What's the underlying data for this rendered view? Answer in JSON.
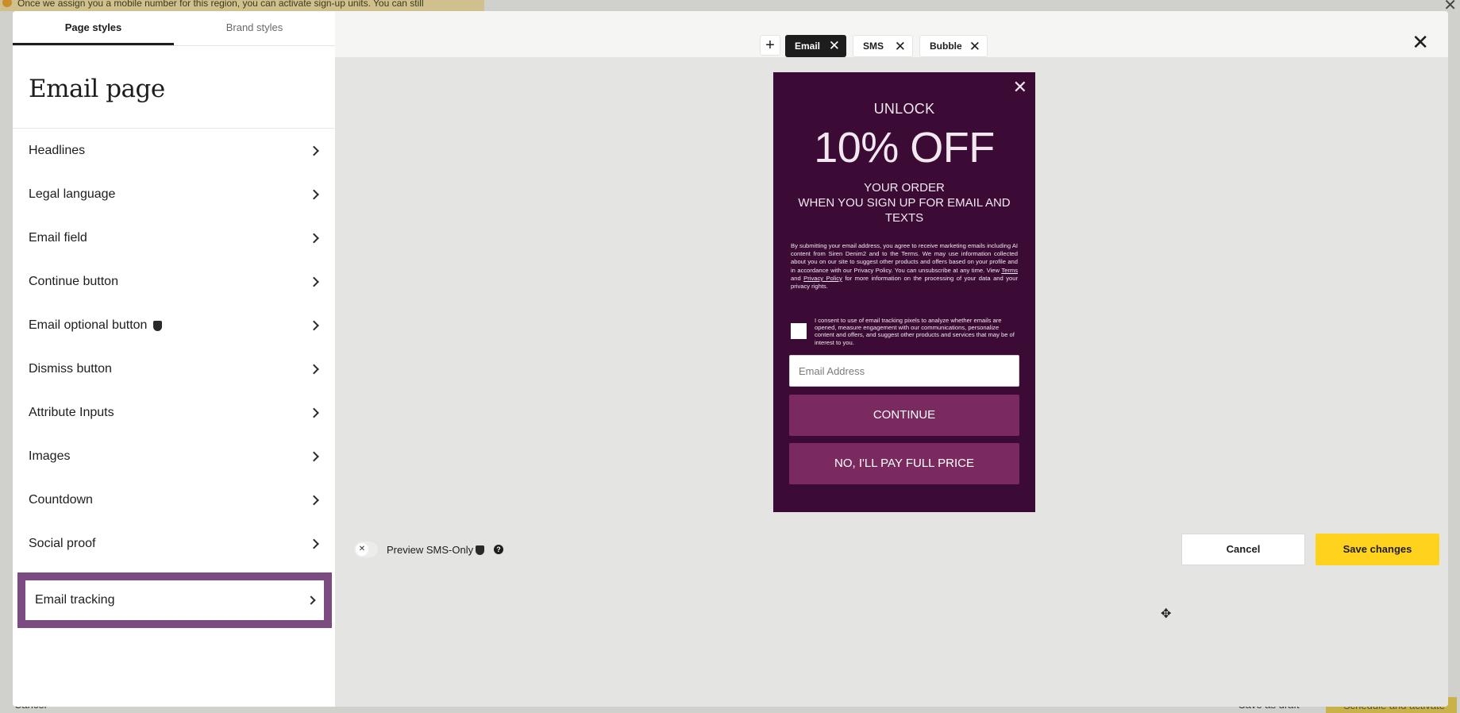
{
  "background_page": {
    "banner_text": "Once we assign you a mobile number for this region, you can activate sign-up units. You can still",
    "bottom_left_text": "Cancel",
    "save_draft_label": "Save as draft",
    "schedule_label": "Schedule and activate"
  },
  "sidebar": {
    "tabs": [
      {
        "label": "Page styles",
        "active": true
      },
      {
        "label": "Brand styles",
        "active": false
      }
    ],
    "title": "Email page",
    "items": [
      {
        "label": "Headlines"
      },
      {
        "label": "Legal language"
      },
      {
        "label": "Email field"
      },
      {
        "label": "Continue button"
      },
      {
        "label": "Email optional button",
        "badge": "shield-icon"
      },
      {
        "label": "Dismiss button"
      },
      {
        "label": "Attribute Inputs"
      },
      {
        "label": "Images"
      },
      {
        "label": "Countdown"
      },
      {
        "label": "Social proof"
      },
      {
        "label": "Email tracking",
        "highlighted": true
      }
    ]
  },
  "topbar": {
    "add_symbol": "+",
    "tabs": [
      {
        "label": "Email",
        "active": true
      },
      {
        "label": "SMS",
        "active": false
      },
      {
        "label": "Bubble",
        "active": false
      }
    ],
    "close_symbol": "✕"
  },
  "popup": {
    "unlock": "UNLOCK",
    "offer": "10% OFF",
    "sub_line1": "YOUR ORDER",
    "sub_line2": "WHEN YOU SIGN UP FOR EMAIL AND TEXTS",
    "legal_prefix": "By submitting your email address, you agree to receive marketing emails including AI content from Siren Denim2 and to the Terms. We may use information collected about you on our site to suggest other products and offers based on your profile and in accordance with our Privacy Policy. You can unsubscribe at any time. View ",
    "legal_terms": "Terms",
    "legal_and": " and ",
    "legal_privacy": "Privacy Policy",
    "legal_suffix": " for more information on the processing of your data and your privacy rights.",
    "consent_text": "I consent to use of email tracking pixels to analyze whether emails are opened, measure engagement with our communications, personalize content and offers, and suggest other products and services that may be of interest to you.",
    "email_placeholder": "Email Address",
    "continue_label": "CONTINUE",
    "decline_label": "NO, I'LL PAY FULL PRICE",
    "colors": {
      "background": "#3b0b35",
      "button": "#7a2a5f"
    }
  },
  "toolbar": {
    "preview_label": "Preview SMS-Only",
    "cancel_label": "Cancel",
    "save_label": "Save changes",
    "save_color": "#ffd21e"
  }
}
